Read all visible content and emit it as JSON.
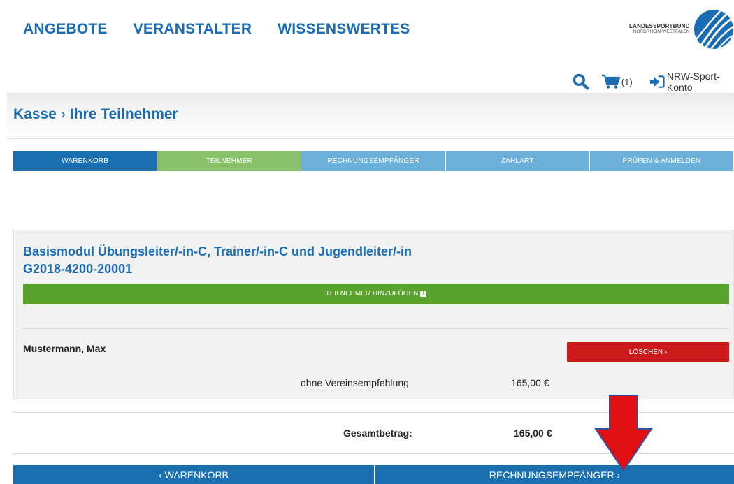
{
  "nav": {
    "items": [
      {
        "label": "ANGEBOTE"
      },
      {
        "label": "VERANSTALTER"
      },
      {
        "label": "WISSENSWERTES"
      }
    ]
  },
  "logo": {
    "line1": "LANDESSPORTBUND",
    "line2": "NORDRHEIN-WESTFALEN"
  },
  "utility": {
    "search_icon": "search-icon",
    "cart_icon": "cart-icon",
    "cart_count": "(1)",
    "account_icon": "sign-in-icon",
    "account_label": "NRW-Sport-Konto"
  },
  "page": {
    "breadcrumb_parent": "Kasse",
    "breadcrumb_sep": "›",
    "breadcrumb_current": "Ihre Teilnehmer"
  },
  "steps": [
    {
      "label": "WARENKORB",
      "state": "done"
    },
    {
      "label": "TEILNEHMER",
      "state": "current"
    },
    {
      "label": "RECHNUNGSEMPFÄNGER",
      "state": "todo"
    },
    {
      "label": "ZAHLART",
      "state": "todo"
    },
    {
      "label": "PRÜFEN & ANMELDEN",
      "state": "todo"
    }
  ],
  "course": {
    "title": "Basismodul Übungsleiter/-in-C, Trainer/-in-C und Jugendleiter/-in",
    "code": "G2018-4200-20001",
    "add_button": "TEILNEHMER HINZUFÜGEN",
    "add_icon": "plus-square-icon",
    "participant_name": "Mustermann, Max",
    "delete_button": "LÖSCHEN ›",
    "option_label": "ohne Vereinsempfehlung",
    "option_price": "165,00 €"
  },
  "summary": {
    "total_label": "Gesamtbetrag:",
    "total_value": "165,00 €"
  },
  "footer": {
    "back_button": "‹ WARENKORB",
    "next_button": "RECHNUNGSEMPFÄNGER ›"
  },
  "colors": {
    "brand_blue": "#1b6db3",
    "step_current_green": "#88c16a",
    "step_todo_blue": "#6cb1d9",
    "add_green": "#5aa22e",
    "delete_red": "#cc1a1a",
    "annotation_arrow": "#e01010"
  },
  "annotation": {
    "icon": "red-down-arrow-icon"
  }
}
